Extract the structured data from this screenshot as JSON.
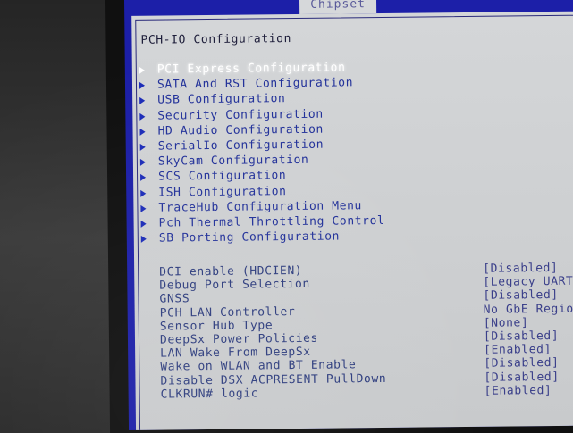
{
  "tabs": {
    "active": "Chipset"
  },
  "page_title": "PCH-IO Configuration",
  "menu_items": [
    {
      "label": "PCI Express Configuration",
      "selected": true
    },
    {
      "label": "SATA And RST Configuration"
    },
    {
      "label": "USB Configuration"
    },
    {
      "label": "Security Configuration"
    },
    {
      "label": "HD Audio Configuration"
    },
    {
      "label": "SerialIo Configuration"
    },
    {
      "label": "SkyCam Configuration"
    },
    {
      "label": "SCS Configuration"
    },
    {
      "label": "ISH Configuration"
    },
    {
      "label": "TraceHub Configuration Menu"
    },
    {
      "label": "Pch Thermal Throttling Control"
    },
    {
      "label": "SB Porting Configuration"
    }
  ],
  "settings": [
    {
      "label": "DCI enable (HDCIEN)",
      "value": "[Disabled]"
    },
    {
      "label": "Debug Port Selection",
      "value": "[Legacy UART"
    },
    {
      "label": "GNSS",
      "value": "[Disabled]"
    },
    {
      "label": "PCH LAN Controller",
      "value": "No GbE Regio"
    },
    {
      "label": "Sensor Hub Type",
      "value": "[None]"
    },
    {
      "label": "DeepSx Power Policies",
      "value": "[Disabled]"
    },
    {
      "label": "LAN Wake From DeepSx",
      "value": "[Enabled]"
    },
    {
      "label": "Wake on WLAN and BT Enable",
      "value": "[Disabled]"
    },
    {
      "label": "Disable DSX ACPRESENT PullDown",
      "value": "[Disabled]"
    },
    {
      "label": "CLKRUN# logic",
      "value": "[Enabled]"
    }
  ],
  "colors": {
    "bios_blue": "#1c1fa8",
    "panel_gray": "#cfd1d3",
    "menu_text": "#23329a",
    "selected_text": "#ffffff"
  }
}
